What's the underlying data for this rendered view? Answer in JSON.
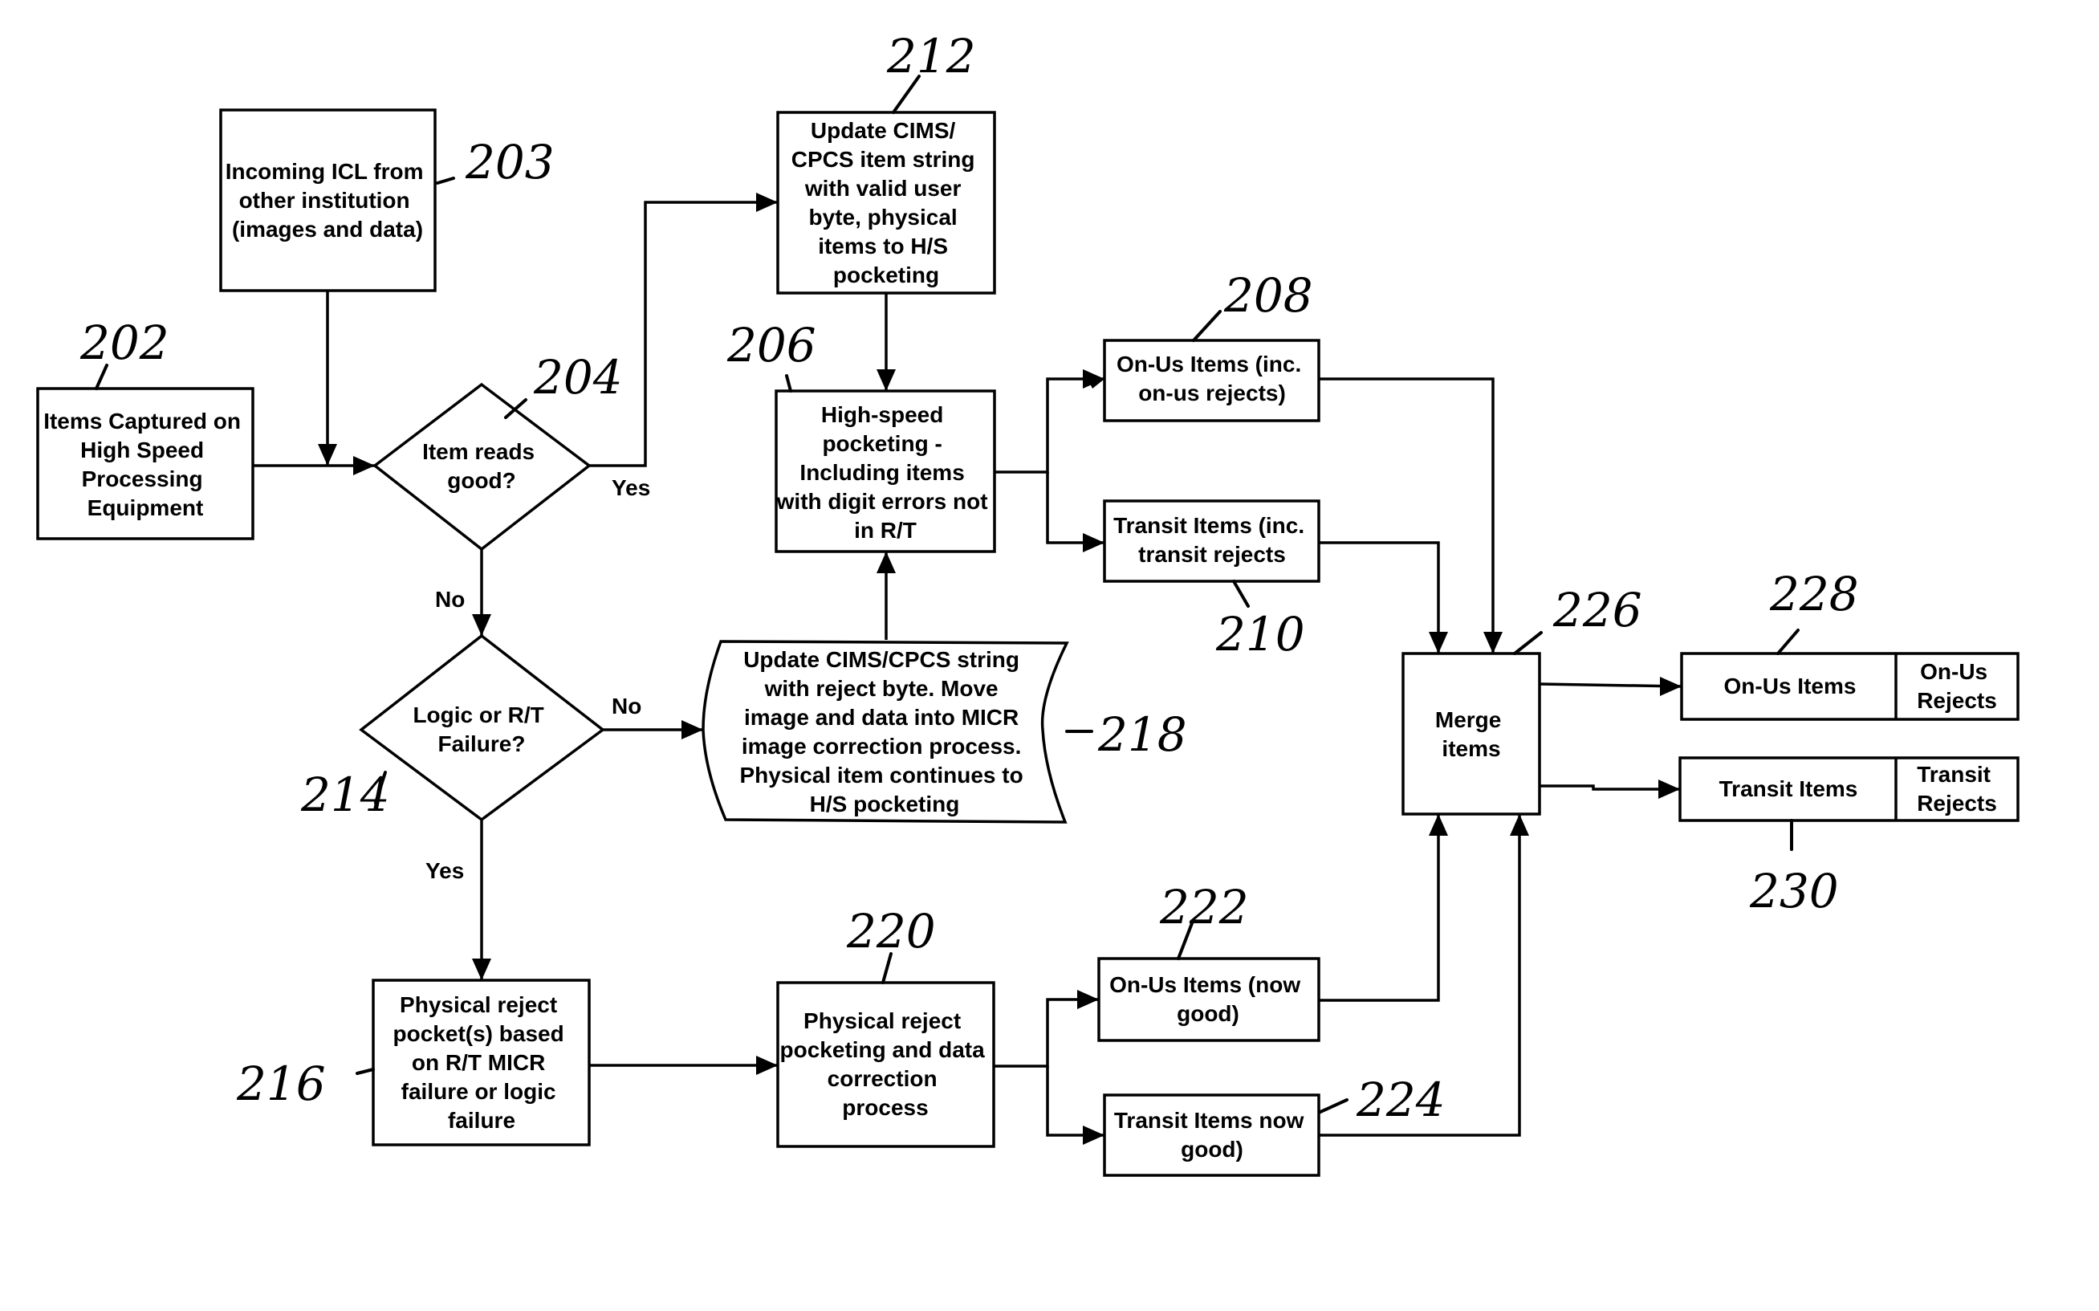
{
  "nodes": {
    "n202": {
      "ref": "202",
      "shape": "rectangle",
      "lines": [
        "Items Captured on",
        "High Speed",
        "Processing",
        "Equipment"
      ]
    },
    "n203": {
      "ref": "203",
      "shape": "rectangle",
      "lines": [
        "Incoming ICL from",
        "other institution",
        "(images and data)"
      ]
    },
    "n204": {
      "ref": "204",
      "shape": "decision",
      "lines": [
        "Item reads",
        "good?"
      ]
    },
    "n212": {
      "ref": "212",
      "shape": "rectangle",
      "lines": [
        "Update CIMS/",
        "CPCS item string",
        "with valid user",
        "byte, physical",
        "items to H/S",
        "pocketing"
      ]
    },
    "n206": {
      "ref": "206",
      "shape": "rectangle",
      "lines": [
        "High-speed",
        "pocketing -",
        "Including items",
        "with digit errors not",
        "in R/T"
      ]
    },
    "n208": {
      "ref": "208",
      "shape": "rectangle",
      "lines": [
        "On-Us Items (inc.",
        "on-us rejects)"
      ]
    },
    "n210": {
      "ref": "210",
      "shape": "rectangle",
      "lines": [
        "Transit Items (inc.",
        "transit rejects"
      ]
    },
    "n214": {
      "ref": "214",
      "shape": "decision",
      "lines": [
        "Logic or R/T",
        "Failure?"
      ]
    },
    "n218": {
      "ref": "218",
      "shape": "document",
      "lines": [
        "Update CIMS/CPCS string",
        "with reject byte.  Move",
        "image and data into MICR",
        "image correction process.",
        "Physical item continues to",
        "H/S pocketing"
      ]
    },
    "n216": {
      "ref": "216",
      "shape": "rectangle",
      "lines": [
        "Physical reject",
        "pocket(s) based",
        "on R/T MICR",
        "failure or logic",
        "failure"
      ]
    },
    "n220": {
      "ref": "220",
      "shape": "rectangle",
      "lines": [
        "Physical reject",
        "pocketing and data",
        "correction",
        "process"
      ]
    },
    "n222": {
      "ref": "222",
      "shape": "rectangle",
      "lines": [
        "On-Us Items (now",
        "good)"
      ]
    },
    "n224": {
      "ref": "224",
      "shape": "rectangle",
      "lines": [
        "Transit Items now",
        "good)"
      ]
    },
    "n226": {
      "ref": "226",
      "shape": "rectangle",
      "lines": [
        "Merge",
        "items"
      ]
    },
    "n228": {
      "ref": "228",
      "shape": "split-rectangle",
      "left_lines": [
        "On-Us Items"
      ],
      "right_lines": [
        "On-Us",
        "Rejects"
      ]
    },
    "n230": {
      "ref": "230",
      "shape": "split-rectangle",
      "left_lines": [
        "Transit Items"
      ],
      "right_lines": [
        "Transit",
        "Rejects"
      ]
    }
  },
  "edges": [
    {
      "from": "202",
      "to": "204",
      "label": ""
    },
    {
      "from": "203",
      "to": "204",
      "label": ""
    },
    {
      "from": "204",
      "to": "212",
      "label": "Yes"
    },
    {
      "from": "204",
      "to": "214",
      "label": "No"
    },
    {
      "from": "212",
      "to": "206",
      "label": ""
    },
    {
      "from": "206",
      "to": "208",
      "label": ""
    },
    {
      "from": "206",
      "to": "210",
      "label": ""
    },
    {
      "from": "214",
      "to": "218",
      "label": "No"
    },
    {
      "from": "214",
      "to": "216",
      "label": "Yes"
    },
    {
      "from": "218",
      "to": "206",
      "label": ""
    },
    {
      "from": "216",
      "to": "220",
      "label": ""
    },
    {
      "from": "220",
      "to": "222",
      "label": ""
    },
    {
      "from": "220",
      "to": "224",
      "label": ""
    },
    {
      "from": "208",
      "to": "226",
      "label": ""
    },
    {
      "from": "210",
      "to": "226",
      "label": ""
    },
    {
      "from": "222",
      "to": "226",
      "label": ""
    },
    {
      "from": "224",
      "to": "226",
      "label": ""
    },
    {
      "from": "226",
      "to": "228",
      "label": ""
    },
    {
      "from": "226",
      "to": "230",
      "label": ""
    }
  ],
  "edge_labels": {
    "yes_204": "Yes",
    "no_204": "No",
    "no_214": "No",
    "yes_214": "Yes"
  }
}
